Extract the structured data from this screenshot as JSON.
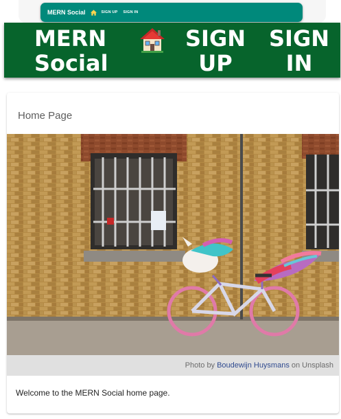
{
  "mini_bar": {
    "title": "MERN Social",
    "home_icon": "home-icon",
    "links": [
      "SIGN UP",
      "SIGN IN"
    ],
    "color": "#00897b"
  },
  "main_bar": {
    "title": "MERN Social",
    "home_icon": "house-emoji-icon",
    "links": [
      "SIGN UP",
      "SIGN IN"
    ],
    "color": "#07642c"
  },
  "card": {
    "title": "Home Page",
    "photo_icon": "unicorn-bicycle-photo",
    "caption": {
      "prefix": "Photo by",
      "author": "Boudewijn Huysmans",
      "suffix": "on Unsplash"
    },
    "body": "Welcome to the MERN Social home page."
  }
}
